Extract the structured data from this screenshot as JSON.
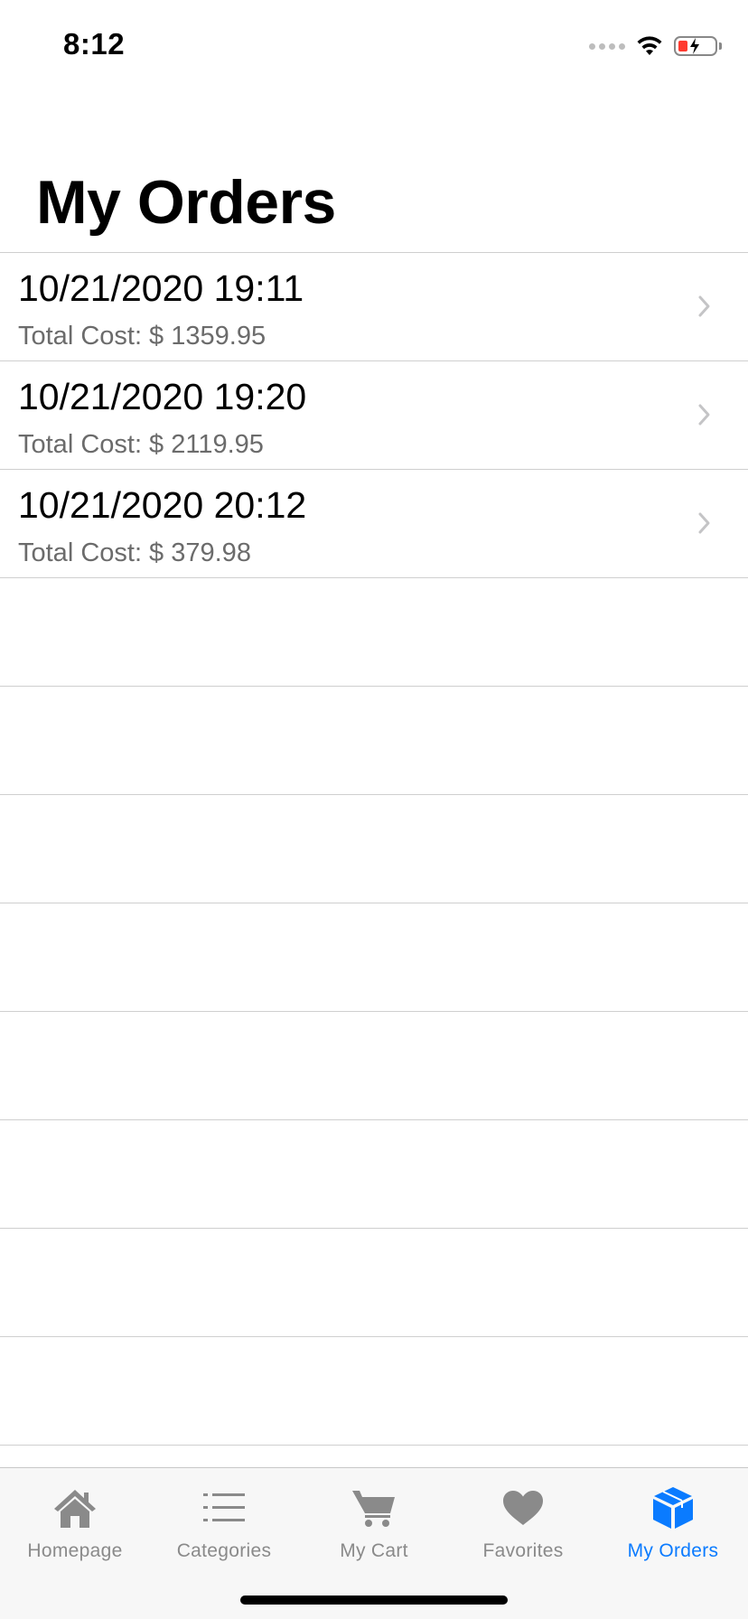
{
  "status_bar": {
    "time": "8:12",
    "battery_color": "#ff3b30"
  },
  "page": {
    "title": "My Orders"
  },
  "orders": [
    {
      "date": "10/21/2020 19:11",
      "total": "Total Cost: $ 1359.95"
    },
    {
      "date": "10/21/2020 19:20",
      "total": "Total Cost: $ 2119.95"
    },
    {
      "date": "10/21/2020 20:12",
      "total": "Total Cost: $ 379.98"
    }
  ],
  "tabbar": {
    "active_color": "#0a7bff",
    "inactive_color": "#8a8a8a",
    "tabs": [
      {
        "label": "Homepage",
        "icon": "house-icon"
      },
      {
        "label": "Categories",
        "icon": "list-icon"
      },
      {
        "label": "My Cart",
        "icon": "cart-icon"
      },
      {
        "label": "Favorites",
        "icon": "heart-icon"
      },
      {
        "label": "My Orders",
        "icon": "box-icon",
        "active": true
      }
    ]
  }
}
